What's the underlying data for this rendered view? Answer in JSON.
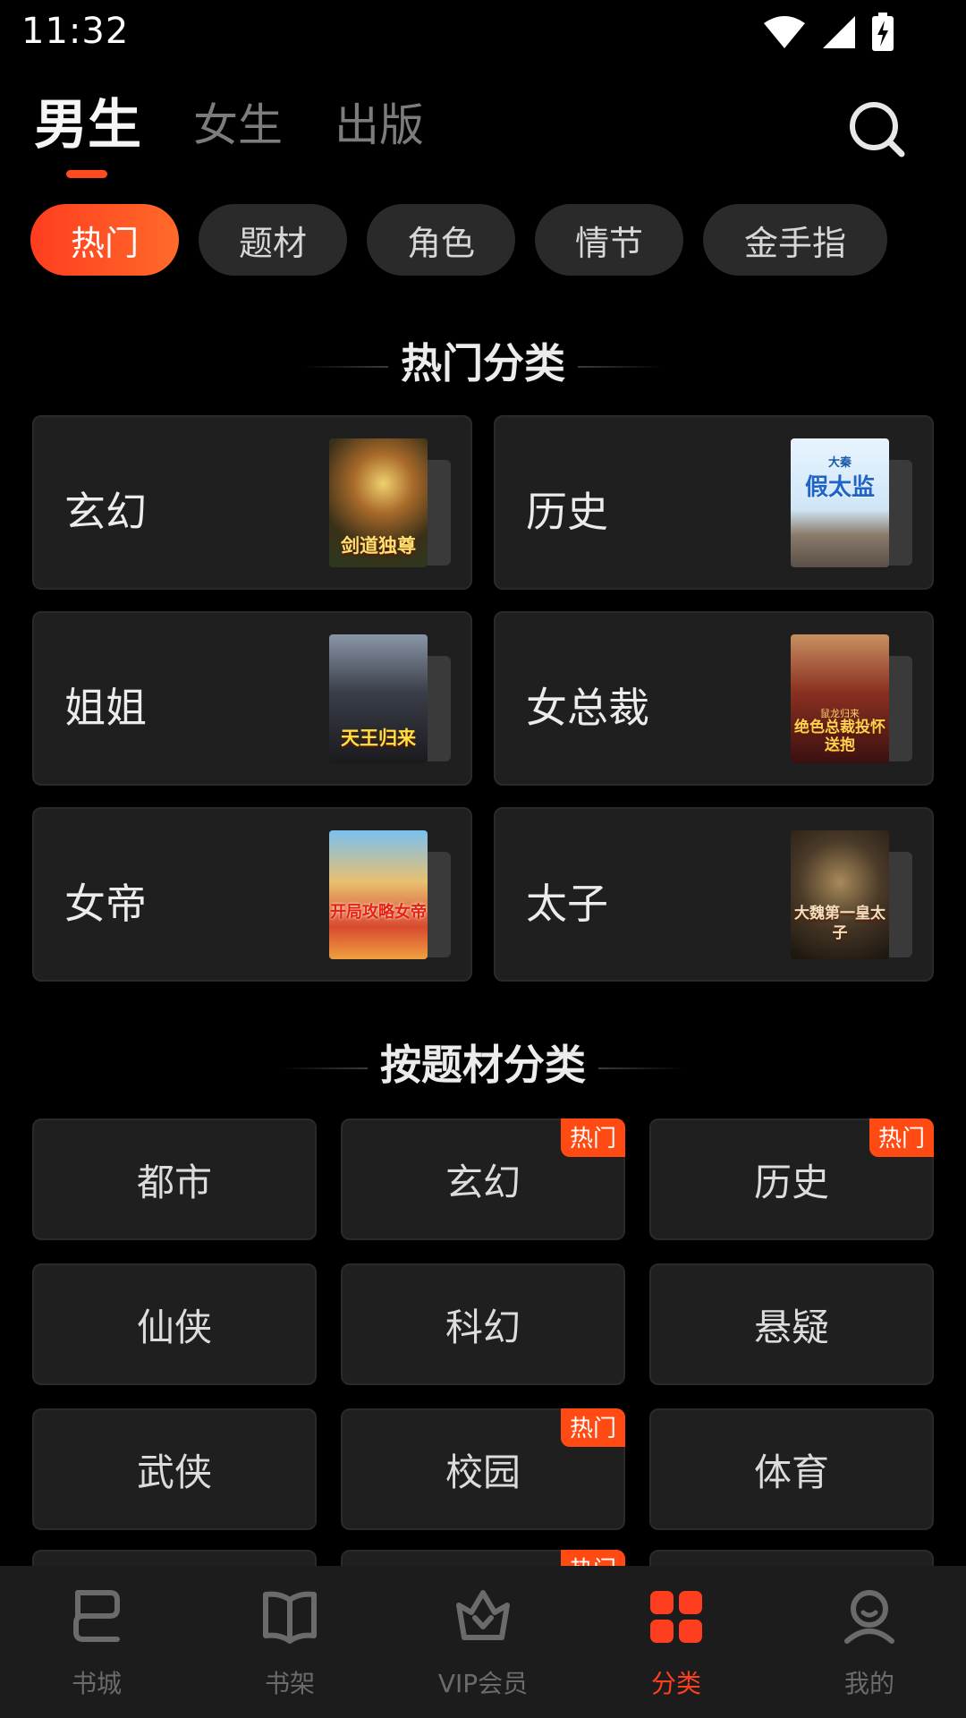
{
  "status": {
    "time": "11:32"
  },
  "top_tabs": [
    {
      "label": "男生",
      "active": true
    },
    {
      "label": "女生",
      "active": false
    },
    {
      "label": "出版",
      "active": false
    }
  ],
  "chips": [
    {
      "label": "热门",
      "active": true
    },
    {
      "label": "题材",
      "active": false
    },
    {
      "label": "角色",
      "active": false
    },
    {
      "label": "情节",
      "active": false
    },
    {
      "label": "金手指",
      "active": false
    }
  ],
  "hot_section": {
    "title": "热门分类",
    "cards": [
      {
        "label": "玄幻",
        "cover_title": "剑道独尊"
      },
      {
        "label": "历史",
        "cover_title": "假太监",
        "cover_top": "大秦"
      },
      {
        "label": "姐姐",
        "cover_title": "天王归来"
      },
      {
        "label": "女总裁",
        "cover_title": "绝色总裁投怀送抱",
        "cover_top": "鼠龙归来"
      },
      {
        "label": "女帝",
        "cover_title": "开局攻略女帝"
      },
      {
        "label": "太子",
        "cover_title": "大魏第一皇太子"
      }
    ]
  },
  "topic_section": {
    "title": "按题材分类",
    "badge_label": "热门",
    "topics": [
      {
        "label": "都市",
        "hot": false
      },
      {
        "label": "玄幻",
        "hot": true
      },
      {
        "label": "历史",
        "hot": true
      },
      {
        "label": "仙侠",
        "hot": false
      },
      {
        "label": "科幻",
        "hot": false
      },
      {
        "label": "悬疑",
        "hot": false
      },
      {
        "label": "武侠",
        "hot": false
      },
      {
        "label": "校园",
        "hot": true
      },
      {
        "label": "体育",
        "hot": false
      }
    ]
  },
  "bottom_nav": [
    {
      "label": "书城",
      "icon": "bookstore-icon",
      "active": false
    },
    {
      "label": "书架",
      "icon": "bookshelf-icon",
      "active": false
    },
    {
      "label": "VIP会员",
      "icon": "vip-crown-icon",
      "active": false
    },
    {
      "label": "分类",
      "icon": "category-grid-icon",
      "active": true
    },
    {
      "label": "我的",
      "icon": "profile-icon",
      "active": false
    }
  ],
  "colors": {
    "accent": "#ff3d1f",
    "card_bg": "#1f1f1f",
    "chip_bg": "#2a2a2a",
    "nav_bg": "#1c1c1c",
    "badge": "#ff4a14"
  }
}
